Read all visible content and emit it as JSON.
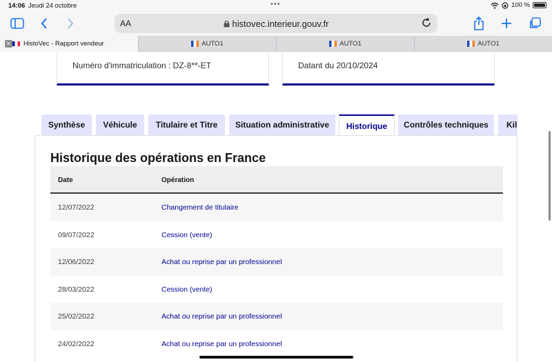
{
  "status": {
    "time": "14:06",
    "date": "Jeudi 24 octobre",
    "battery": "100 %",
    "icons": [
      "wifi-icon",
      "orientation-lock-icon",
      "battery-icon"
    ]
  },
  "toolbar": {
    "text_size_label": "AA",
    "url": "histovec.interieur.gouv.fr",
    "icons": [
      "sidebar-icon",
      "back-icon",
      "forward-icon",
      "lock-icon",
      "reload-icon",
      "share-icon",
      "new-tab-icon",
      "tabs-overview-icon"
    ]
  },
  "browser_tabs": [
    {
      "label": "HistoVec - Rapport vendeur",
      "active": true
    },
    {
      "label": "AUTO1",
      "active": false
    },
    {
      "label": "AUTO1",
      "active": false
    },
    {
      "label": "AUTO1",
      "active": false
    }
  ],
  "cards": {
    "registration": "Numéro d'immatriculation : DZ-8**-ET",
    "dated": "Datant du 20/10/2024"
  },
  "nav_tabs": [
    {
      "label": "Synthèse"
    },
    {
      "label": "Véhicule"
    },
    {
      "label": "Titulaire et Titre"
    },
    {
      "label": "Situation administrative"
    },
    {
      "label": "Historique",
      "active": true
    },
    {
      "label": "Contrôles techniques"
    },
    {
      "label": "Kilo"
    }
  ],
  "history": {
    "title": "Historique des opérations en France",
    "columns": {
      "date": "Date",
      "operation": "Opération"
    },
    "rows": [
      {
        "date": "12/07/2022",
        "operation": "Changement de titulaire"
      },
      {
        "date": "09/07/2022",
        "operation": "Cession (vente)"
      },
      {
        "date": "12/06/2022",
        "operation": "Achat ou reprise par un professionnel"
      },
      {
        "date": "28/03/2022",
        "operation": "Cession (vente)"
      },
      {
        "date": "25/02/2022",
        "operation": "Achat ou reprise par un professionnel"
      },
      {
        "date": "24/02/2022",
        "operation": "Achat ou reprise par un professionnel"
      }
    ]
  },
  "colors": {
    "accent": "#000091",
    "tab_background": "#e3e3fd",
    "ios_blue": "#1a73e8"
  }
}
